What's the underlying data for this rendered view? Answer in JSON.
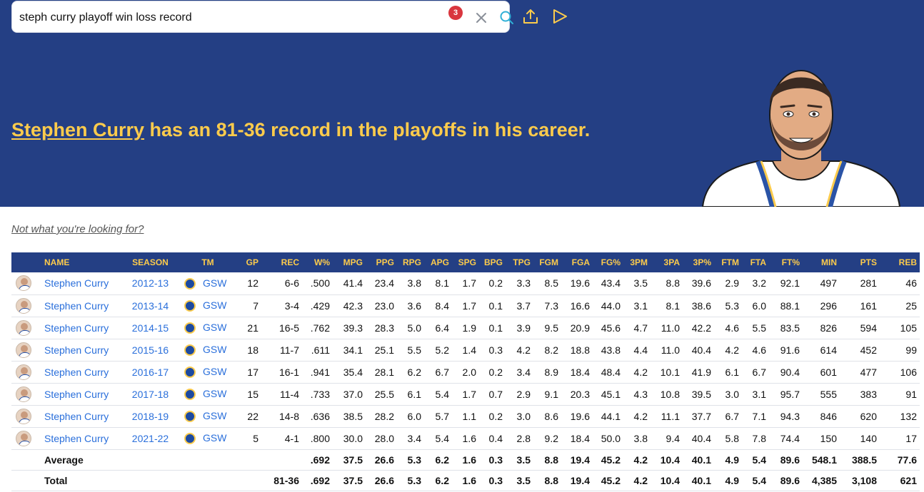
{
  "search": {
    "query": "steph curry playoff win loss record",
    "badge_count": "3"
  },
  "headline": {
    "player_name": "Stephen Curry",
    "rest": " has an 81-36 record in the playoffs in his career."
  },
  "not_looking": "Not what you're looking for?",
  "colors": {
    "hero_bg": "#243f84",
    "accent_yellow": "#fccb4c",
    "link_blue": "#2a6fdb",
    "badge_red": "#d9363e"
  },
  "icons": {
    "clear": "close-icon",
    "search": "search-icon",
    "share": "share-upload-icon",
    "play": "play-icon"
  },
  "table": {
    "headers": [
      "",
      "NAME",
      "SEASON",
      "TM",
      "GP",
      "REC",
      "W%",
      "MPG",
      "PPG",
      "RPG",
      "APG",
      "SPG",
      "BPG",
      "TPG",
      "FGM",
      "FGA",
      "FG%",
      "3PM",
      "3PA",
      "3P%",
      "FTM",
      "FTA",
      "FT%",
      "MIN",
      "PTS",
      "REB"
    ],
    "rows": [
      {
        "name": "Stephen Curry",
        "season": "2012-13",
        "tm": "GSW",
        "gp": "12",
        "rec": "6-6",
        "wpct": ".500",
        "mpg": "41.4",
        "ppg": "23.4",
        "rpg": "3.8",
        "apg": "8.1",
        "spg": "1.7",
        "bpg": "0.2",
        "tpg": "3.3",
        "fgm": "8.5",
        "fga": "19.6",
        "fgpct": "43.4",
        "tpm": "3.5",
        "tpa": "8.8",
        "tppct": "39.6",
        "ftm": "2.9",
        "fta": "3.2",
        "ftpct": "92.1",
        "min": "497",
        "pts": "281",
        "reb": "46"
      },
      {
        "name": "Stephen Curry",
        "season": "2013-14",
        "tm": "GSW",
        "gp": "7",
        "rec": "3-4",
        "wpct": ".429",
        "mpg": "42.3",
        "ppg": "23.0",
        "rpg": "3.6",
        "apg": "8.4",
        "spg": "1.7",
        "bpg": "0.1",
        "tpg": "3.7",
        "fgm": "7.3",
        "fga": "16.6",
        "fgpct": "44.0",
        "tpm": "3.1",
        "tpa": "8.1",
        "tppct": "38.6",
        "ftm": "5.3",
        "fta": "6.0",
        "ftpct": "88.1",
        "min": "296",
        "pts": "161",
        "reb": "25"
      },
      {
        "name": "Stephen Curry",
        "season": "2014-15",
        "tm": "GSW",
        "gp": "21",
        "rec": "16-5",
        "wpct": ".762",
        "mpg": "39.3",
        "ppg": "28.3",
        "rpg": "5.0",
        "apg": "6.4",
        "spg": "1.9",
        "bpg": "0.1",
        "tpg": "3.9",
        "fgm": "9.5",
        "fga": "20.9",
        "fgpct": "45.6",
        "tpm": "4.7",
        "tpa": "11.0",
        "tppct": "42.2",
        "ftm": "4.6",
        "fta": "5.5",
        "ftpct": "83.5",
        "min": "826",
        "pts": "594",
        "reb": "105"
      },
      {
        "name": "Stephen Curry",
        "season": "2015-16",
        "tm": "GSW",
        "gp": "18",
        "rec": "11-7",
        "wpct": ".611",
        "mpg": "34.1",
        "ppg": "25.1",
        "rpg": "5.5",
        "apg": "5.2",
        "spg": "1.4",
        "bpg": "0.3",
        "tpg": "4.2",
        "fgm": "8.2",
        "fga": "18.8",
        "fgpct": "43.8",
        "tpm": "4.4",
        "tpa": "11.0",
        "tppct": "40.4",
        "ftm": "4.2",
        "fta": "4.6",
        "ftpct": "91.6",
        "min": "614",
        "pts": "452",
        "reb": "99"
      },
      {
        "name": "Stephen Curry",
        "season": "2016-17",
        "tm": "GSW",
        "gp": "17",
        "rec": "16-1",
        "wpct": ".941",
        "mpg": "35.4",
        "ppg": "28.1",
        "rpg": "6.2",
        "apg": "6.7",
        "spg": "2.0",
        "bpg": "0.2",
        "tpg": "3.4",
        "fgm": "8.9",
        "fga": "18.4",
        "fgpct": "48.4",
        "tpm": "4.2",
        "tpa": "10.1",
        "tppct": "41.9",
        "ftm": "6.1",
        "fta": "6.7",
        "ftpct": "90.4",
        "min": "601",
        "pts": "477",
        "reb": "106"
      },
      {
        "name": "Stephen Curry",
        "season": "2017-18",
        "tm": "GSW",
        "gp": "15",
        "rec": "11-4",
        "wpct": ".733",
        "mpg": "37.0",
        "ppg": "25.5",
        "rpg": "6.1",
        "apg": "5.4",
        "spg": "1.7",
        "bpg": "0.7",
        "tpg": "2.9",
        "fgm": "9.1",
        "fga": "20.3",
        "fgpct": "45.1",
        "tpm": "4.3",
        "tpa": "10.8",
        "tppct": "39.5",
        "ftm": "3.0",
        "fta": "3.1",
        "ftpct": "95.7",
        "min": "555",
        "pts": "383",
        "reb": "91"
      },
      {
        "name": "Stephen Curry",
        "season": "2018-19",
        "tm": "GSW",
        "gp": "22",
        "rec": "14-8",
        "wpct": ".636",
        "mpg": "38.5",
        "ppg": "28.2",
        "rpg": "6.0",
        "apg": "5.7",
        "spg": "1.1",
        "bpg": "0.2",
        "tpg": "3.0",
        "fgm": "8.6",
        "fga": "19.6",
        "fgpct": "44.1",
        "tpm": "4.2",
        "tpa": "11.1",
        "tppct": "37.7",
        "ftm": "6.7",
        "fta": "7.1",
        "ftpct": "94.3",
        "min": "846",
        "pts": "620",
        "reb": "132"
      },
      {
        "name": "Stephen Curry",
        "season": "2021-22",
        "tm": "GSW",
        "gp": "5",
        "rec": "4-1",
        "wpct": ".800",
        "mpg": "30.0",
        "ppg": "28.0",
        "rpg": "3.4",
        "apg": "5.4",
        "spg": "1.6",
        "bpg": "0.4",
        "tpg": "2.8",
        "fgm": "9.2",
        "fga": "18.4",
        "fgpct": "50.0",
        "tpm": "3.8",
        "tpa": "9.4",
        "tppct": "40.4",
        "ftm": "5.8",
        "fta": "7.8",
        "ftpct": "74.4",
        "min": "150",
        "pts": "140",
        "reb": "17"
      }
    ],
    "average": {
      "label": "Average",
      "gp": "",
      "rec": "",
      "wpct": ".692",
      "mpg": "37.5",
      "ppg": "26.6",
      "rpg": "5.3",
      "apg": "6.2",
      "spg": "1.6",
      "bpg": "0.3",
      "tpg": "3.5",
      "fgm": "8.8",
      "fga": "19.4",
      "fgpct": "45.2",
      "tpm": "4.2",
      "tpa": "10.4",
      "tppct": "40.1",
      "ftm": "4.9",
      "fta": "5.4",
      "ftpct": "89.6",
      "min": "548.1",
      "pts": "388.5",
      "reb": "77.6"
    },
    "total": {
      "label": "Total",
      "gp": "",
      "rec": "81-36",
      "wpct": ".692",
      "mpg": "37.5",
      "ppg": "26.6",
      "rpg": "5.3",
      "apg": "6.2",
      "spg": "1.6",
      "bpg": "0.3",
      "tpg": "3.5",
      "fgm": "8.8",
      "fga": "19.4",
      "fgpct": "45.2",
      "tpm": "4.2",
      "tpa": "10.4",
      "tppct": "40.1",
      "ftm": "4.9",
      "fta": "5.4",
      "ftpct": "89.6",
      "min": "4,385",
      "pts": "3,108",
      "reb": "621"
    }
  }
}
